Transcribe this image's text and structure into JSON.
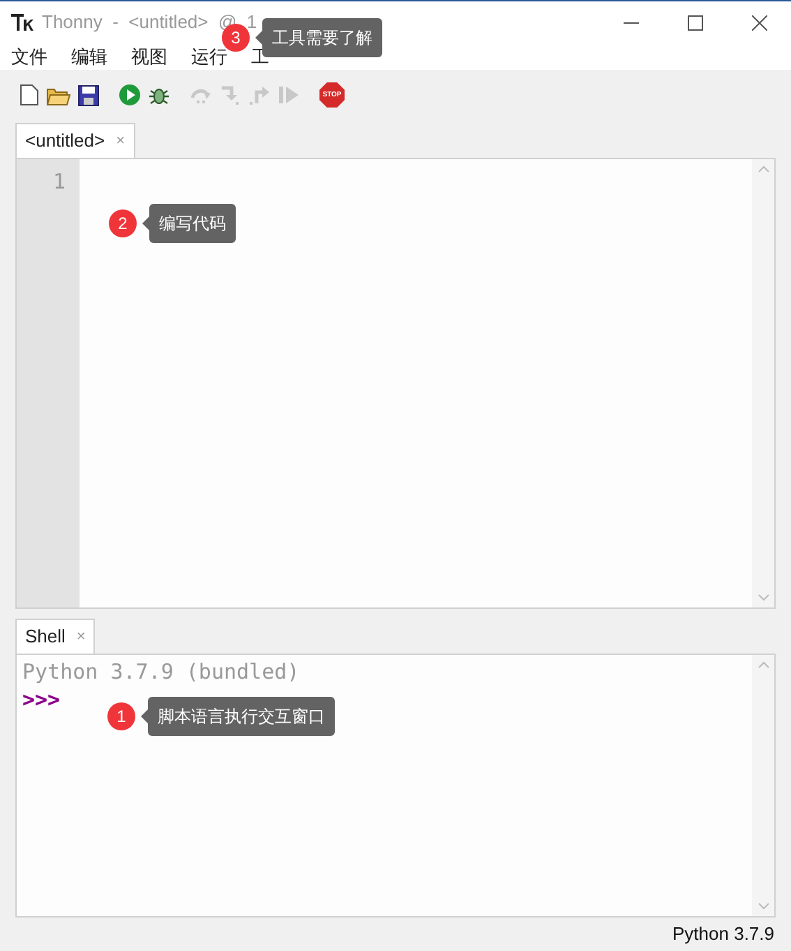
{
  "window": {
    "title": "Thonny  -  <untitled>  @  1"
  },
  "menu": [
    {
      "label": "文件"
    },
    {
      "label": "编辑"
    },
    {
      "label": "视图"
    },
    {
      "label": "运行"
    },
    {
      "label": "工"
    }
  ],
  "toolbar": [
    {
      "kind": "new",
      "disabled": false
    },
    {
      "kind": "open",
      "disabled": false
    },
    {
      "kind": "save",
      "disabled": false
    },
    {
      "kind": "run",
      "disabled": false
    },
    {
      "kind": "debug",
      "disabled": false
    },
    {
      "kind": "step-over",
      "disabled": true
    },
    {
      "kind": "step-into",
      "disabled": true
    },
    {
      "kind": "step-out",
      "disabled": true
    },
    {
      "kind": "resume",
      "disabled": true
    },
    {
      "kind": "stop",
      "disabled": false,
      "label": "STOP"
    }
  ],
  "editor": {
    "tab": {
      "label": "<untitled>",
      "close": "×"
    },
    "line_numbers": [
      "1"
    ]
  },
  "shell": {
    "tab": {
      "label": "Shell",
      "close": "×"
    },
    "lines": [
      "Python 3.7.9 (bundled)"
    ],
    "prompt": ">>>"
  },
  "status_bar": {
    "text": "Python 3.7.9"
  },
  "callouts": [
    {
      "number": "3",
      "text": "工具需要了解"
    },
    {
      "number": "2",
      "text": "编写代码"
    },
    {
      "number": "1",
      "text": "脚本语言执行交互窗口"
    }
  ]
}
